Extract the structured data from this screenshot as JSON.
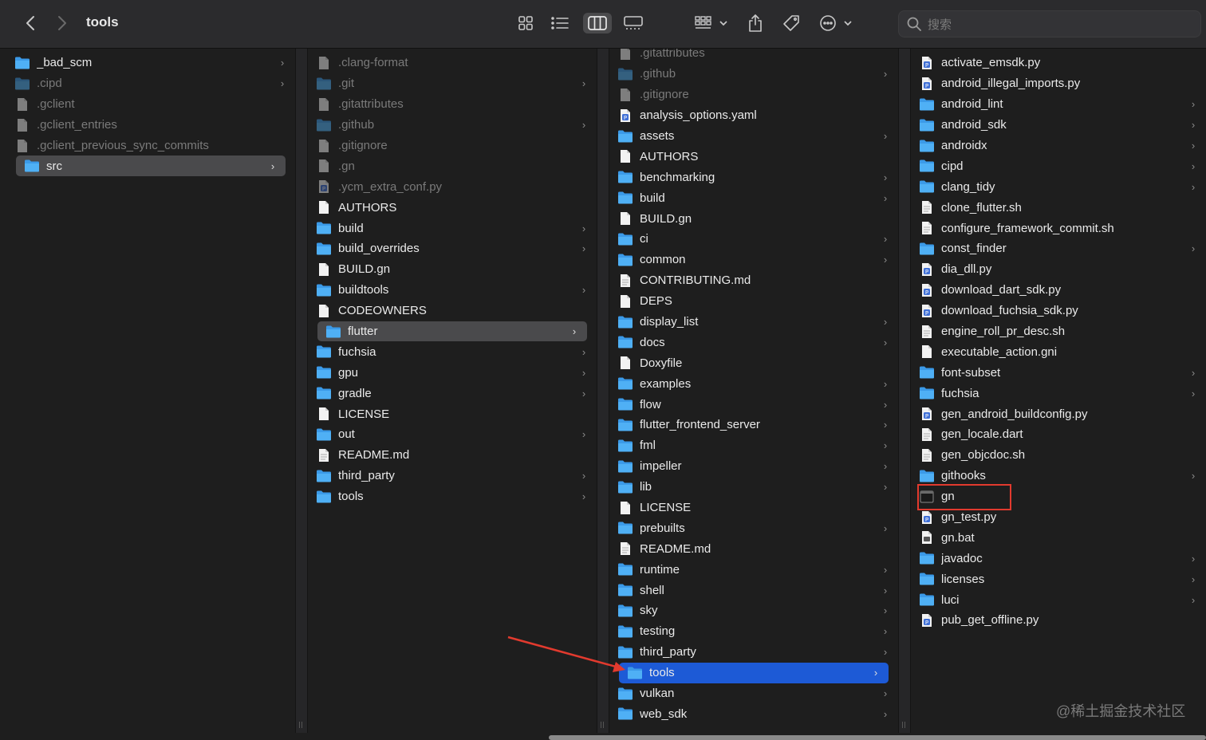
{
  "window": {
    "title": "tools",
    "search_placeholder": "搜索",
    "watermark": "@稀土掘金技术社区"
  },
  "toolbar": {
    "icons": [
      "chevron-left-icon",
      "chevron-right-icon",
      "icon-view-icon",
      "list-view-icon",
      "column-view-icon",
      "gallery-view-icon",
      "group-icon",
      "share-icon",
      "tag-icon",
      "more-icon"
    ],
    "active_view": "column"
  },
  "columns": [
    {
      "items": [
        {
          "name": "_bad_scm",
          "kind": "folder",
          "dim": false,
          "chevron": true
        },
        {
          "name": ".cipd",
          "kind": "folder",
          "dim": true,
          "chevron": true
        },
        {
          "name": ".gclient",
          "kind": "file",
          "dim": true,
          "chevron": false
        },
        {
          "name": ".gclient_entries",
          "kind": "file",
          "dim": true,
          "chevron": false
        },
        {
          "name": ".gclient_previous_sync_commits",
          "kind": "file",
          "dim": true,
          "chevron": false
        },
        {
          "name": "src",
          "kind": "folder",
          "dim": false,
          "chevron": true,
          "selected": "grey"
        }
      ]
    },
    {
      "items": [
        {
          "name": ".clang-format",
          "kind": "file",
          "dim": true,
          "chevron": false
        },
        {
          "name": ".git",
          "kind": "folder",
          "dim": true,
          "chevron": true
        },
        {
          "name": ".gitattributes",
          "kind": "file",
          "dim": true,
          "chevron": false
        },
        {
          "name": ".github",
          "kind": "folder",
          "dim": true,
          "chevron": true
        },
        {
          "name": ".gitignore",
          "kind": "file",
          "dim": true,
          "chevron": false
        },
        {
          "name": ".gn",
          "kind": "file",
          "dim": true,
          "chevron": false
        },
        {
          "name": ".ycm_extra_conf.py",
          "kind": "python",
          "dim": true,
          "chevron": false
        },
        {
          "name": "AUTHORS",
          "kind": "file",
          "dim": false,
          "chevron": false
        },
        {
          "name": "build",
          "kind": "folder",
          "dim": false,
          "chevron": true
        },
        {
          "name": "build_overrides",
          "kind": "folder",
          "dim": false,
          "chevron": true
        },
        {
          "name": "BUILD.gn",
          "kind": "file",
          "dim": false,
          "chevron": false
        },
        {
          "name": "buildtools",
          "kind": "folder",
          "dim": false,
          "chevron": true
        },
        {
          "name": "CODEOWNERS",
          "kind": "file",
          "dim": false,
          "chevron": false
        },
        {
          "name": "flutter",
          "kind": "folder",
          "dim": false,
          "chevron": true,
          "selected": "grey"
        },
        {
          "name": "fuchsia",
          "kind": "folder",
          "dim": false,
          "chevron": true
        },
        {
          "name": "gpu",
          "kind": "folder",
          "dim": false,
          "chevron": true
        },
        {
          "name": "gradle",
          "kind": "folder",
          "dim": false,
          "chevron": true
        },
        {
          "name": "LICENSE",
          "kind": "file",
          "dim": false,
          "chevron": false
        },
        {
          "name": "out",
          "kind": "folder",
          "dim": false,
          "chevron": true
        },
        {
          "name": "README.md",
          "kind": "doc",
          "dim": false,
          "chevron": false
        },
        {
          "name": "third_party",
          "kind": "folder",
          "dim": false,
          "chevron": true
        },
        {
          "name": "tools",
          "kind": "folder",
          "dim": false,
          "chevron": true
        }
      ]
    },
    {
      "items": [
        {
          "name": ".gitattributes",
          "kind": "file",
          "dim": true,
          "chevron": false
        },
        {
          "name": ".github",
          "kind": "folder",
          "dim": true,
          "chevron": true
        },
        {
          "name": ".gitignore",
          "kind": "file",
          "dim": true,
          "chevron": false
        },
        {
          "name": "analysis_options.yaml",
          "kind": "python",
          "dim": false,
          "chevron": false
        },
        {
          "name": "assets",
          "kind": "folder",
          "dim": false,
          "chevron": true
        },
        {
          "name": "AUTHORS",
          "kind": "file",
          "dim": false,
          "chevron": false
        },
        {
          "name": "benchmarking",
          "kind": "folder",
          "dim": false,
          "chevron": true
        },
        {
          "name": "build",
          "kind": "folder",
          "dim": false,
          "chevron": true
        },
        {
          "name": "BUILD.gn",
          "kind": "file",
          "dim": false,
          "chevron": false
        },
        {
          "name": "ci",
          "kind": "folder",
          "dim": false,
          "chevron": true
        },
        {
          "name": "common",
          "kind": "folder",
          "dim": false,
          "chevron": true
        },
        {
          "name": "CONTRIBUTING.md",
          "kind": "doc",
          "dim": false,
          "chevron": false
        },
        {
          "name": "DEPS",
          "kind": "file",
          "dim": false,
          "chevron": false
        },
        {
          "name": "display_list",
          "kind": "folder",
          "dim": false,
          "chevron": true
        },
        {
          "name": "docs",
          "kind": "folder",
          "dim": false,
          "chevron": true
        },
        {
          "name": "Doxyfile",
          "kind": "file",
          "dim": false,
          "chevron": false
        },
        {
          "name": "examples",
          "kind": "folder",
          "dim": false,
          "chevron": true
        },
        {
          "name": "flow",
          "kind": "folder",
          "dim": false,
          "chevron": true
        },
        {
          "name": "flutter_frontend_server",
          "kind": "folder",
          "dim": false,
          "chevron": true
        },
        {
          "name": "fml",
          "kind": "folder",
          "dim": false,
          "chevron": true
        },
        {
          "name": "impeller",
          "kind": "folder",
          "dim": false,
          "chevron": true
        },
        {
          "name": "lib",
          "kind": "folder",
          "dim": false,
          "chevron": true
        },
        {
          "name": "LICENSE",
          "kind": "file",
          "dim": false,
          "chevron": false
        },
        {
          "name": "prebuilts",
          "kind": "folder",
          "dim": false,
          "chevron": true
        },
        {
          "name": "README.md",
          "kind": "doc",
          "dim": false,
          "chevron": false
        },
        {
          "name": "runtime",
          "kind": "folder",
          "dim": false,
          "chevron": true
        },
        {
          "name": "shell",
          "kind": "folder",
          "dim": false,
          "chevron": true
        },
        {
          "name": "sky",
          "kind": "folder",
          "dim": false,
          "chevron": true
        },
        {
          "name": "testing",
          "kind": "folder",
          "dim": false,
          "chevron": true
        },
        {
          "name": "third_party",
          "kind": "folder",
          "dim": false,
          "chevron": true
        },
        {
          "name": "tools",
          "kind": "folder",
          "dim": false,
          "chevron": true,
          "selected": "blue"
        },
        {
          "name": "vulkan",
          "kind": "folder",
          "dim": false,
          "chevron": true
        },
        {
          "name": "web_sdk",
          "kind": "folder",
          "dim": false,
          "chevron": true
        }
      ]
    },
    {
      "items": [
        {
          "name": "activate_emsdk.py",
          "kind": "python",
          "dim": false,
          "chevron": false
        },
        {
          "name": "android_illegal_imports.py",
          "kind": "python",
          "dim": false,
          "chevron": false
        },
        {
          "name": "android_lint",
          "kind": "folder",
          "dim": false,
          "chevron": true
        },
        {
          "name": "android_sdk",
          "kind": "folder",
          "dim": false,
          "chevron": true
        },
        {
          "name": "androidx",
          "kind": "folder",
          "dim": false,
          "chevron": true
        },
        {
          "name": "cipd",
          "kind": "folder",
          "dim": false,
          "chevron": true
        },
        {
          "name": "clang_tidy",
          "kind": "folder",
          "dim": false,
          "chevron": true
        },
        {
          "name": "clone_flutter.sh",
          "kind": "doc",
          "dim": false,
          "chevron": false
        },
        {
          "name": "configure_framework_commit.sh",
          "kind": "doc",
          "dim": false,
          "chevron": false
        },
        {
          "name": "const_finder",
          "kind": "folder",
          "dim": false,
          "chevron": true
        },
        {
          "name": "dia_dll.py",
          "kind": "python",
          "dim": false,
          "chevron": false
        },
        {
          "name": "download_dart_sdk.py",
          "kind": "python",
          "dim": false,
          "chevron": false
        },
        {
          "name": "download_fuchsia_sdk.py",
          "kind": "python",
          "dim": false,
          "chevron": false
        },
        {
          "name": "engine_roll_pr_desc.sh",
          "kind": "doc",
          "dim": false,
          "chevron": false
        },
        {
          "name": "executable_action.gni",
          "kind": "file",
          "dim": false,
          "chevron": false
        },
        {
          "name": "font-subset",
          "kind": "folder",
          "dim": false,
          "chevron": true
        },
        {
          "name": "fuchsia",
          "kind": "folder",
          "dim": false,
          "chevron": true
        },
        {
          "name": "gen_android_buildconfig.py",
          "kind": "python",
          "dim": false,
          "chevron": false
        },
        {
          "name": "gen_locale.dart",
          "kind": "doc",
          "dim": false,
          "chevron": false
        },
        {
          "name": "gen_objcdoc.sh",
          "kind": "doc",
          "dim": false,
          "chevron": false
        },
        {
          "name": "githooks",
          "kind": "folder",
          "dim": false,
          "chevron": true
        },
        {
          "name": "gn",
          "kind": "exec",
          "dim": false,
          "chevron": false
        },
        {
          "name": "gn_test.py",
          "kind": "python",
          "dim": false,
          "chevron": false
        },
        {
          "name": "gn.bat",
          "kind": "bat",
          "dim": false,
          "chevron": false
        },
        {
          "name": "javadoc",
          "kind": "folder",
          "dim": false,
          "chevron": true
        },
        {
          "name": "licenses",
          "kind": "folder",
          "dim": false,
          "chevron": true
        },
        {
          "name": "luci",
          "kind": "folder",
          "dim": false,
          "chevron": true
        },
        {
          "name": "pub_get_offline.py",
          "kind": "python",
          "dim": false,
          "chevron": false
        }
      ]
    }
  ]
}
